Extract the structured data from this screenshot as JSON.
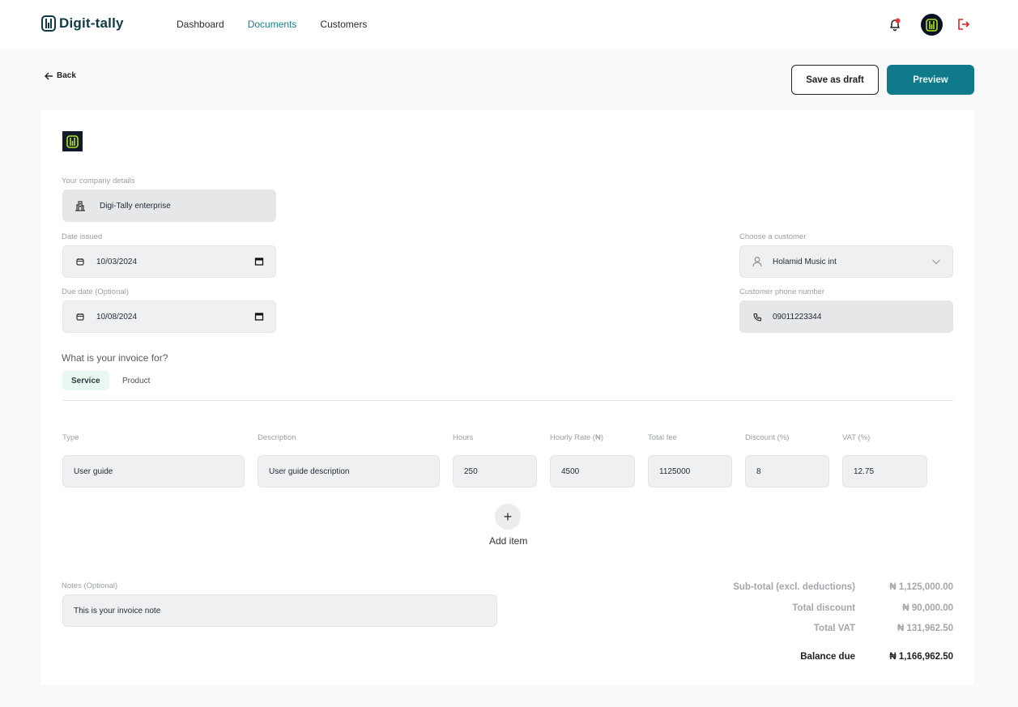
{
  "header": {
    "brand": "Digit-tally",
    "nav": [
      {
        "label": "Dashboard",
        "active": false
      },
      {
        "label": "Documents",
        "active": true
      },
      {
        "label": "Customers",
        "active": false
      }
    ],
    "icons": [
      "bell-icon",
      "avatar",
      "logout-icon"
    ]
  },
  "toolbar": {
    "back_label": "Back",
    "save_draft_label": "Save as draft",
    "preview_label": "Preview"
  },
  "colors": {
    "accent": "#0f7b8a",
    "nav_active": "#1a7f92",
    "brand_text": "#0f3a46",
    "logo_green": "#b6e21c",
    "logout_red": "#d62828"
  },
  "form": {
    "company": {
      "label": "Your company details",
      "value": "Digi-Tally enterprise"
    },
    "date_issued": {
      "label": "Date issued",
      "value": "10/03/2024"
    },
    "due_date": {
      "label": "Due date (Optional)",
      "value": "10/08/2024"
    },
    "customer": {
      "label": "Choose a customer",
      "value": "Holamid Music int"
    },
    "phone": {
      "label": "Customer phone number",
      "value": "09011223344"
    },
    "invoice_for": {
      "question": "What is your invoice for?",
      "options": [
        {
          "label": "Service",
          "selected": true
        },
        {
          "label": "Product",
          "selected": false
        }
      ]
    }
  },
  "items": {
    "columns": [
      "Type",
      "Description",
      "Hours",
      "Hourly Rate (₦)",
      "Total fee",
      "Discount (%)",
      "VAT (%)"
    ],
    "rows": [
      {
        "type": "User guide",
        "description": "User guide description",
        "hours": "250",
        "rate": "4500",
        "total": "1125000",
        "discount": "8",
        "vat": "12.75"
      }
    ],
    "add_label": "Add item",
    "add_icon": "+"
  },
  "notes": {
    "label": "Notes (Optional)",
    "value": "This is your invoice note"
  },
  "summary": {
    "subtotal": {
      "label": "Sub-total (excl. deductions)",
      "value": "₦ 1,125,000.00"
    },
    "discount": {
      "label": "Total discount",
      "value": "₦ 90,000.00"
    },
    "vat": {
      "label": "Total VAT",
      "value": "₦ 131,962.50"
    },
    "balance": {
      "label": "Balance due",
      "value": "₦ 1,166,962.50"
    }
  }
}
